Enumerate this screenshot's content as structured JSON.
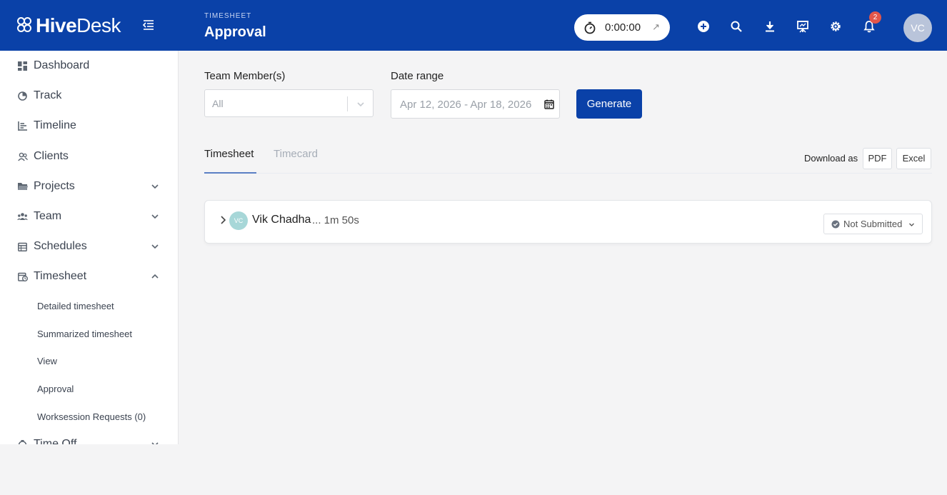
{
  "brand": {
    "logo_bold": "Hive",
    "logo_light": "Desk"
  },
  "header": {
    "kicker": "TIMESHEET",
    "title": "Approval",
    "timer": "0:00:00",
    "notification_count": "2",
    "avatar_initials": "VC"
  },
  "sidebar": {
    "items": [
      {
        "label": "Dashboard",
        "icon": "dashboard-icon"
      },
      {
        "label": "Track",
        "icon": "track-icon"
      },
      {
        "label": "Timeline",
        "icon": "timeline-icon"
      },
      {
        "label": "Clients",
        "icon": "clients-icon"
      },
      {
        "label": "Projects",
        "icon": "folder-icon"
      },
      {
        "label": "Team",
        "icon": "team-icon"
      },
      {
        "label": "Schedules",
        "icon": "calendar-icon"
      },
      {
        "label": "Timesheet",
        "icon": "timesheet-icon"
      },
      {
        "label": "Time Off",
        "icon": "time-off-icon"
      }
    ],
    "timesheet_sub": [
      "Detailed timesheet",
      "Summarized timesheet",
      "View",
      "Approval",
      "Worksession Requests (0)"
    ]
  },
  "filters": {
    "team_label": "Team Member(s)",
    "team_placeholder": "All",
    "date_label": "Date range",
    "date_value": "Apr 12, 2026 - Apr 18, 2026",
    "generate_label": "Generate"
  },
  "tabs": {
    "active": "Timesheet",
    "inactive": "Timecard"
  },
  "download": {
    "label": "Download as",
    "pdf": "PDF",
    "excel": "Excel"
  },
  "entry": {
    "initials": "VC",
    "name": "Vik Chadha",
    "duration": "... 1m 50s",
    "status": "Not Submitted"
  },
  "colors": {
    "brand_blue": "#0a41a8",
    "badge_red": "#e2564a"
  }
}
